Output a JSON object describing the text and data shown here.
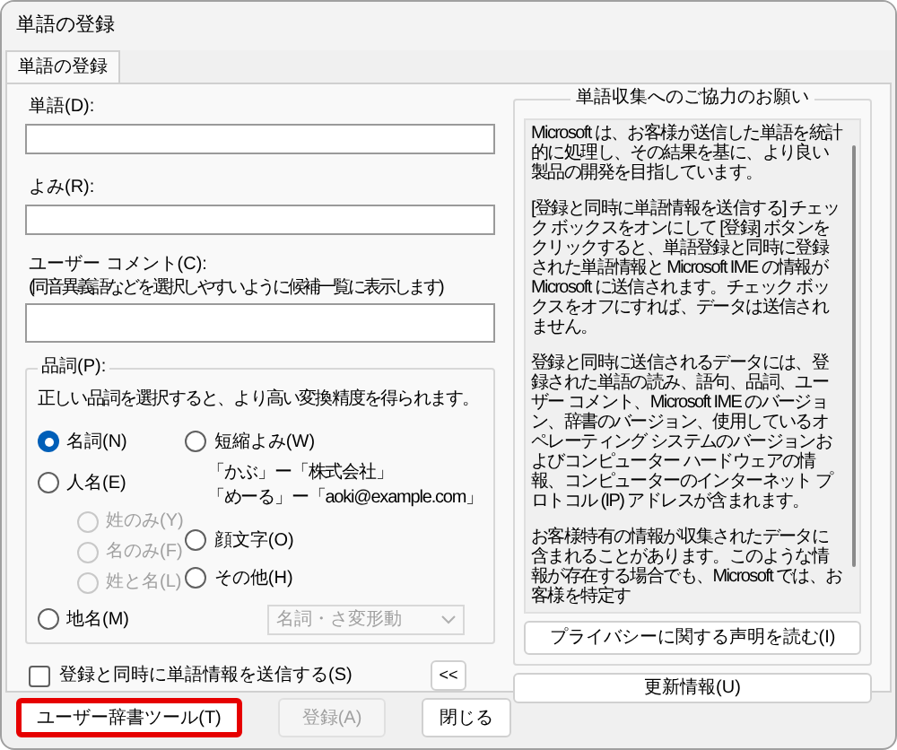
{
  "window": {
    "title": "単語の登録"
  },
  "tabs": [
    {
      "label": "単語の登録",
      "selected": true
    }
  ],
  "fields": [
    {
      "label": "単語(D):"
    },
    {
      "label": "よみ(R):"
    }
  ],
  "comment": {
    "label": "ユーザー コメント(C):",
    "hint": "(同音異義語などを選択しやすいように候補一覧に表示します)"
  },
  "part_of_speech": {
    "title": "品詞(P):",
    "description": "正しい品詞を選択すると、より高い変換精度を得られます。",
    "left_options": [
      {
        "label": "名詞(N)",
        "selected": true,
        "disabled": false
      },
      {
        "label": "人名(E)",
        "selected": false,
        "disabled": false,
        "children": [
          {
            "label": "姓のみ(Y)",
            "selected": false,
            "disabled": true
          },
          {
            "label": "名のみ(F)",
            "selected": false,
            "disabled": true
          },
          {
            "label": "姓と名(L)",
            "selected": false,
            "disabled": true
          }
        ]
      }
    ],
    "right_options": [
      {
        "label": "短縮よみ(W)",
        "selected": false,
        "disabled": false,
        "examples": [
          "「かぶ」ー「株式会社」",
          "「めーる」ー「aoki@example.com」"
        ]
      },
      {
        "label": "顔文字(O)",
        "selected": false,
        "disabled": false
      },
      {
        "label": "その他(H)",
        "selected": false,
        "disabled": false
      }
    ],
    "bottom_option": {
      "label": "地名(M)",
      "selected": false,
      "disabled": false
    },
    "dropdown": {
      "value": "名詞・さ変形動",
      "disabled": true
    }
  },
  "send_checkbox": {
    "label": "登録と同時に単語情報を送信する(S)",
    "checked": false
  },
  "toggle_button": "<<",
  "info": {
    "title": "単語収集へのご協力のお願い",
    "paragraphs": [
      "Microsoft は、お客様が送信した単語を統計的に処理し、その結果を基に、より良い製品の開発を目指しています。",
      "[登録と同時に単語情報を送信する] チェック ボックスをオンにして [登録] ボタンをクリックすると、単語登録と同時に登録された単語情報と Microsoft IME の情報が Microsoft に送信されます。チェック ボックスをオフにすれば、データは送信されません。",
      "登録と同時に送信されるデータには、登録された単語の読み、語句、品詞、ユーザー コメント、Microsoft IME のバージョン、辞書のバージョン、使用しているオペレーティング システムのバージョンおよびコンピューター ハードウェアの情報、コンピューターのインターネット プロトコル (IP) アドレスが含まれます。",
      "お客様特有の情報が収集されたデータに含まれることがあります。このような情報が存在する場合でも、Microsoft では、お客様を特定す"
    ],
    "privacy_button": "プライバシーに関する声明を読む(I)"
  },
  "update_button": "更新情報(U)",
  "buttons": [
    {
      "label": "ユーザー辞書ツール(T)",
      "disabled": false,
      "highlighted": true
    },
    {
      "label": "登録(A)",
      "disabled": true,
      "highlighted": false
    },
    {
      "label": "閉じる",
      "disabled": false,
      "highlighted": false
    }
  ]
}
